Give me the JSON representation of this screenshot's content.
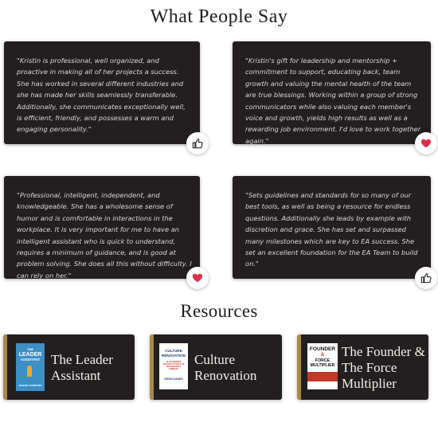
{
  "testimonials": {
    "heading": "What People Say",
    "cards": [
      {
        "quote": "\"Kristin is professional, well organized, and proactive in making all of her projects a success. She has worked in several different industries and she has made her skills seamlessly transferable. Additionally, she communicates exceptionally well, is efficient, friendly, and possesses a warm and engaging personality.\"",
        "reaction_icon": "thumbs-up-icon"
      },
      {
        "quote": "\"Kristin's gift for leadership and mentorship + commitment to support, educating back, team growth and valuing the mental health of the team are true blessings. Working within a group of strong communicators while also valuing each member's voice and growth, yields high results as well as a rewarding job environment. I'd love to work together again.\"",
        "reaction_icon": "heart-icon"
      },
      {
        "quote": "\"Professional, intelligent, independent, and knowledgeable. She has a wholesome sense of humor and is comfortable in interactions in the workplace. It is very important for me to have an intelligent assistant who is quick to understand, requires a minimum of guidance, and is good at problem solving. She does all this without difficulty. I can rely on her.\"",
        "reaction_icon": "heart-icon"
      },
      {
        "quote": "\"Sets guidelines and standards for so many of our best tools, as well as being a resource for endless questions. Additionally she leads by example with discretion and grace. She has set and surpassed many milestones which are key to EA success. She set an excellent foundation for the EA Team to build on.\"",
        "reaction_icon": "thumbs-up-icon"
      }
    ]
  },
  "resources": {
    "heading": "Resources",
    "items": [
      {
        "title": "The Leader Assistant",
        "cover": {
          "line1": "THE",
          "line2": "LEADER",
          "line3": "ASSISTANT",
          "author": "JEREMY BURROWS"
        }
      },
      {
        "title": "Culture Renovation",
        "cover": {
          "line1": "CULTURE",
          "line2": "RENOVATION",
          "line3": "18 LEADERSHIP ACTIONS TO BUILD AN UNSHAKEABLE COMPANY",
          "author": "KEVIN OAKES"
        }
      },
      {
        "title": "The Founder & The Force Multiplier",
        "cover": {
          "line1": "FOUNDER",
          "line2": "&",
          "line3": "FORCE MULTIPLIER",
          "author": ""
        }
      }
    ]
  },
  "colors": {
    "card_bg": "#231f20",
    "accent_gold": "#a88a4a",
    "heart_red": "#d8324a"
  }
}
